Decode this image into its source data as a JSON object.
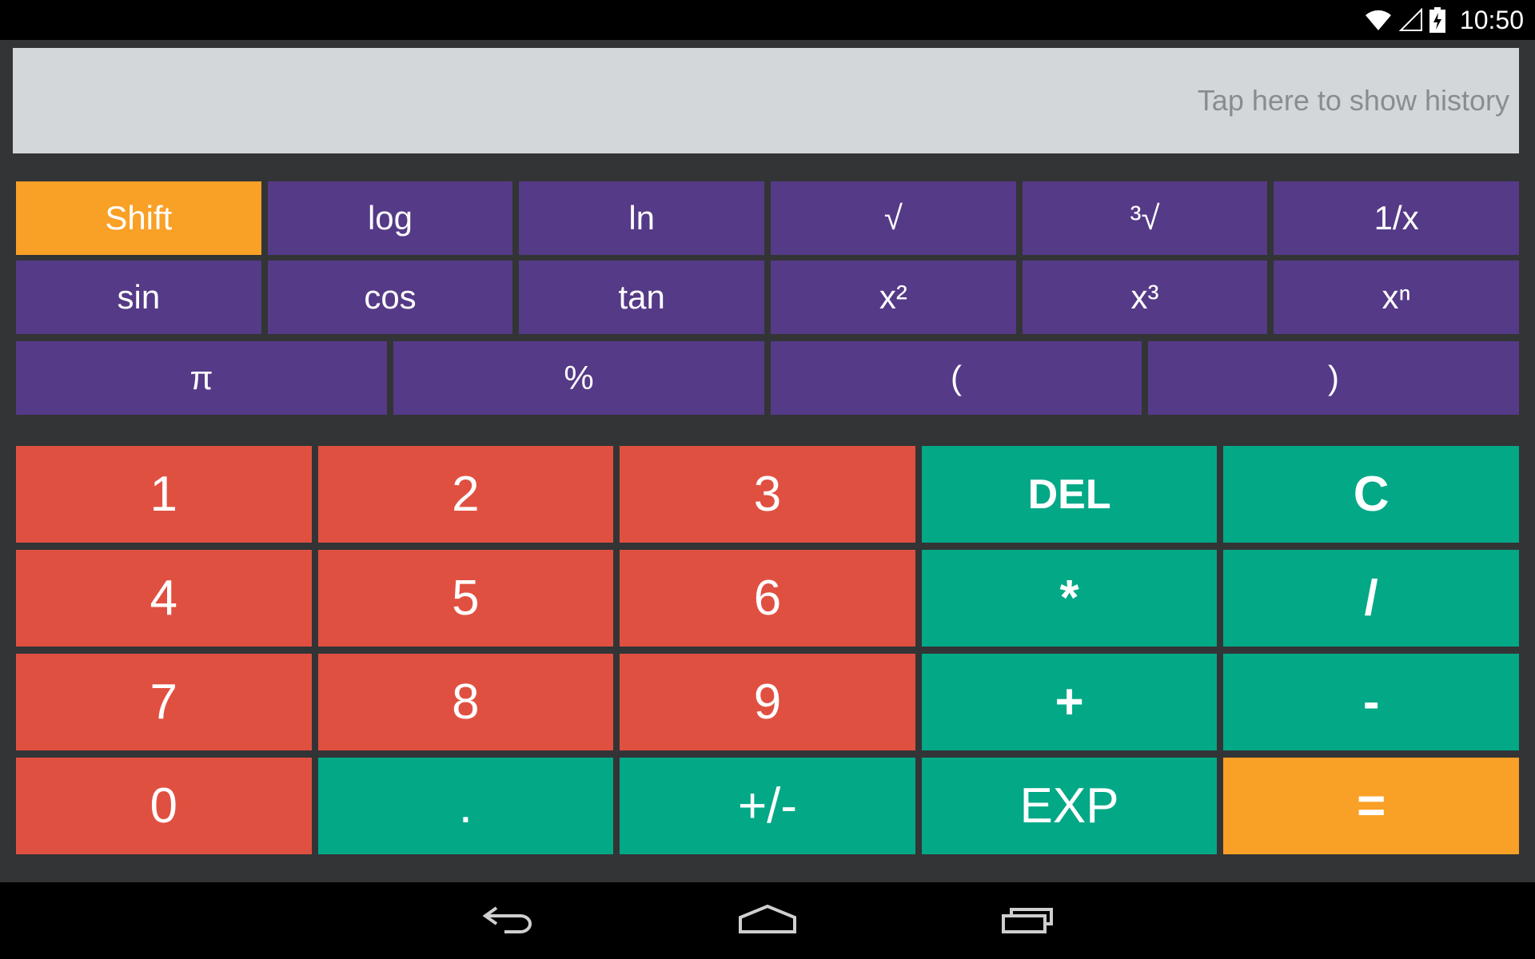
{
  "status_bar": {
    "time": "10:50",
    "icons": [
      "wifi-icon",
      "signal-icon",
      "battery-charging-icon"
    ]
  },
  "display": {
    "history_hint": "Tap here to show history"
  },
  "scientific": {
    "row1": [
      "Shift",
      "log",
      "ln",
      "√",
      "³√",
      "1/x"
    ],
    "row2": [
      "sin",
      "cos",
      "tan",
      "x²",
      "x³",
      "xⁿ"
    ],
    "row3": [
      "π",
      "%",
      "(",
      ")"
    ]
  },
  "keypad": {
    "row1": [
      "1",
      "2",
      "3",
      "DEL",
      "C"
    ],
    "row2": [
      "4",
      "5",
      "6",
      "*",
      "/"
    ],
    "row3": [
      "7",
      "8",
      "9",
      "+",
      "-"
    ],
    "row4": [
      "0",
      ".",
      "+/-",
      "EXP",
      "="
    ]
  },
  "colors": {
    "scientific_key": "#553a87",
    "shift_key": "#f9a026",
    "digit_key": "#e05041",
    "operator_key": "#03a887",
    "equals_key": "#f9a026",
    "display_bg": "#d3d7da",
    "app_bg": "#333436"
  },
  "nav_bar": {
    "icons": [
      "back-icon",
      "home-icon",
      "recent-apps-icon"
    ]
  }
}
